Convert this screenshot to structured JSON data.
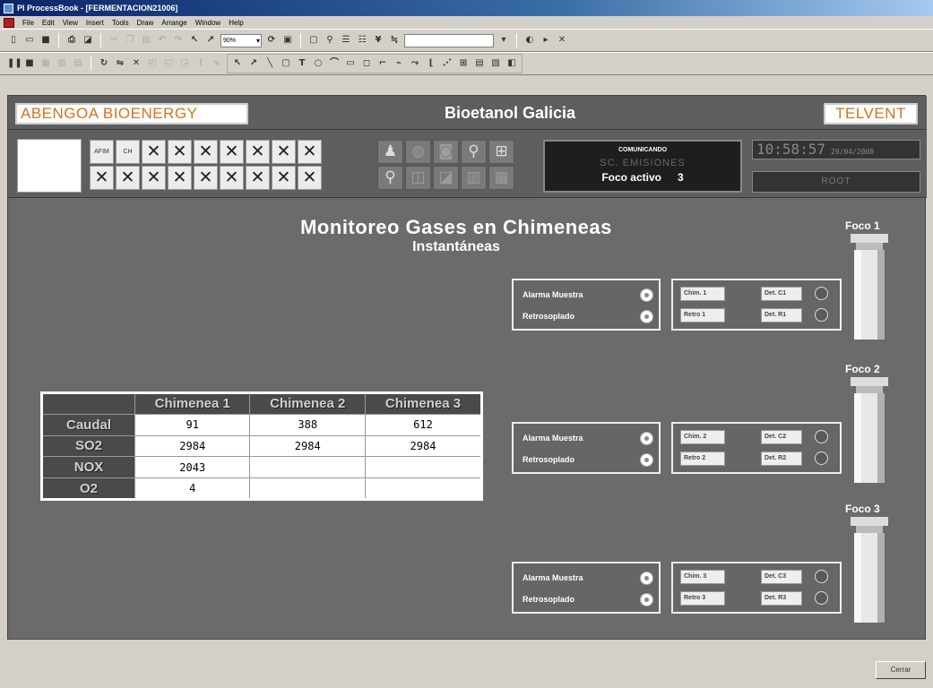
{
  "window": {
    "title": "PI ProcessBook - [FERMENTACION21006]"
  },
  "menu": {
    "items": [
      "File",
      "Edit",
      "View",
      "Insert",
      "Tools",
      "Draw",
      "Arrange",
      "Window",
      "Help"
    ]
  },
  "toolbar": {
    "zoom": "90%"
  },
  "header": {
    "brand_left": "ABENGOA BIOENERGY",
    "plant_title": "Bioetanol Galicia",
    "brand_right": "TELVENT"
  },
  "controls": {
    "label_afm": "AFIM",
    "label_ch": "CH"
  },
  "status": {
    "line1": "COMUNICANDO",
    "line2": "SC. EMISIONES",
    "foco_label": "Foco activo",
    "foco_value": "3",
    "clock": "10:58:57",
    "date": "29/04/2008",
    "user": "ROOT"
  },
  "display": {
    "title": "Monitoreo Gases en Chimeneas",
    "subtitle": "Instantáneas"
  },
  "table": {
    "columns": [
      "Chimenea 1",
      "Chimenea 2",
      "Chimenea 3"
    ],
    "rows": [
      {
        "label": "Caudal",
        "values": [
          "91",
          "388",
          "612"
        ]
      },
      {
        "label": "SO2",
        "values": [
          "2984",
          "2984",
          "2984"
        ]
      },
      {
        "label": "NOX",
        "values": [
          "2043",
          "",
          ""
        ]
      },
      {
        "label": "O2",
        "values": [
          "4",
          "",
          ""
        ]
      }
    ]
  },
  "focos": [
    {
      "label": "Foco 1",
      "alarm_label": "Alarma Muestra",
      "retro_label": "Retrosoplado",
      "chim_label": "Chim. 1",
      "retro_btn": "Retro 1",
      "det_c": "Det. C1",
      "det_r": "Det. R1"
    },
    {
      "label": "Foco 2",
      "alarm_label": "Alarma Muestra",
      "retro_label": "Retrosoplado",
      "chim_label": "Chim. 2",
      "retro_btn": "Retro 2",
      "det_c": "Det. C2",
      "det_r": "Det. R2"
    },
    {
      "label": "Foco 3",
      "alarm_label": "Alarma Muestra",
      "retro_label": "Retrosoplado",
      "chim_label": "Chim. 3",
      "retro_btn": "Retro 3",
      "det_c": "Det. C3",
      "det_r": "Det. R3"
    }
  ],
  "footer": {
    "close_label": "Cerrar"
  }
}
